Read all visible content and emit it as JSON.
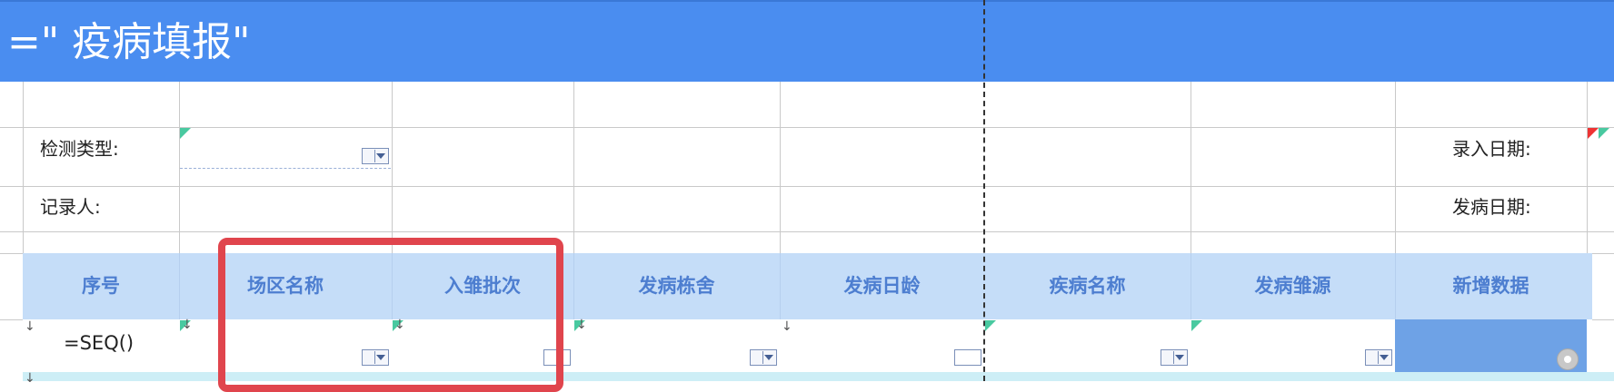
{
  "title": "=\"  疫病填报\"",
  "form": {
    "detection_type_label": "检测类型:",
    "recorder_label": "记录人:",
    "entry_date_label": "录入日期:",
    "onset_date_label": "发病日期:"
  },
  "table": {
    "headers": [
      "序号",
      "场区名称",
      "入雏批次",
      "发病栋舍",
      "发病日龄",
      "疾病名称",
      "发病雏源",
      "新增数据"
    ],
    "first_row": {
      "seq_formula": "=SEQ()"
    }
  },
  "colors": {
    "title_bar": "#4a8df0",
    "header_row": "#c5ddf8",
    "header_text": "#4d7ed0",
    "highlight": "#e0454d",
    "new_data_cell": "#6ea2e6"
  }
}
